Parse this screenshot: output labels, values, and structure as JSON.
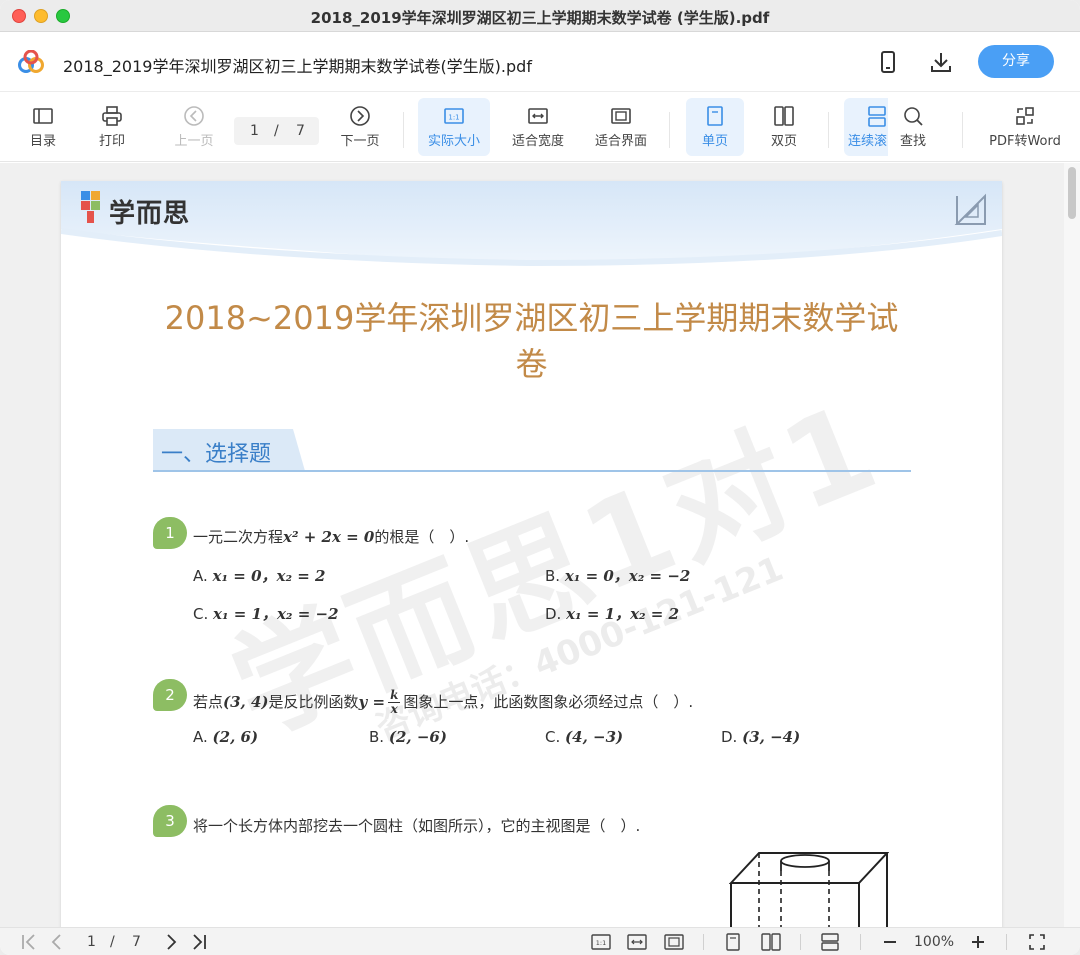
{
  "window": {
    "title": "2018_2019学年深圳罗湖区初三上学期期末数学试卷 (学生版).pdf"
  },
  "header": {
    "doc_title": "2018_2019学年深圳罗湖区初三上学期期末数学试卷(学生版).pdf",
    "share_label": "分享"
  },
  "toolbar": {
    "toc": "目录",
    "print": "打印",
    "prev": "上一页",
    "page_current": "1",
    "page_sep": "/",
    "page_total": "7",
    "next": "下一页",
    "actual_size": "实际大小",
    "fit_width": "适合宽度",
    "fit_page": "适合界面",
    "single": "单页",
    "double": "双页",
    "continuous": "连续滚",
    "find": "查找",
    "pdf_to_word": "PDF转Word"
  },
  "page": {
    "brand": "学而思",
    "heading_line1": "2018~2019学年深圳罗湖区初三上学期期末数学试",
    "heading_line2": "卷",
    "section": "一、选择题",
    "watermark": "学而思1对1",
    "watermark_phone": "咨询电话：4000-121-121",
    "q1": {
      "num": "1",
      "text_pre": "一元二次方程",
      "eq": "x² + 2x = 0",
      "text_post": "的根是（　）.",
      "A_label": "A.",
      "A": "x₁ = 0，x₂ = 2",
      "B_label": "B.",
      "B": "x₁ = 0，x₂ = −2",
      "C_label": "C.",
      "C": "x₁ = 1，x₂ = −2",
      "D_label": "D.",
      "D": "x₁ = 1，x₂ = 2"
    },
    "q2": {
      "num": "2",
      "text_pre": "若点",
      "point": "(3, 4)",
      "text_mid": "是反比例函数",
      "func": "y =",
      "frac_num": "k",
      "frac_den": "x",
      "text_post": "图象上一点，此函数图象必须经过点（　）.",
      "A_label": "A.",
      "A": "(2, 6)",
      "B_label": "B.",
      "B": "(2, −6)",
      "C_label": "C.",
      "C": "(4, −3)",
      "D_label": "D.",
      "D": "(3, −4)"
    },
    "q3": {
      "num": "3",
      "text": "将一个长方体内部挖去一个圆柱（如图所示），它的主视图是（　）."
    }
  },
  "bottombar": {
    "page_current": "1",
    "page_sep": "/",
    "page_total": "7",
    "zoom": "100%"
  }
}
